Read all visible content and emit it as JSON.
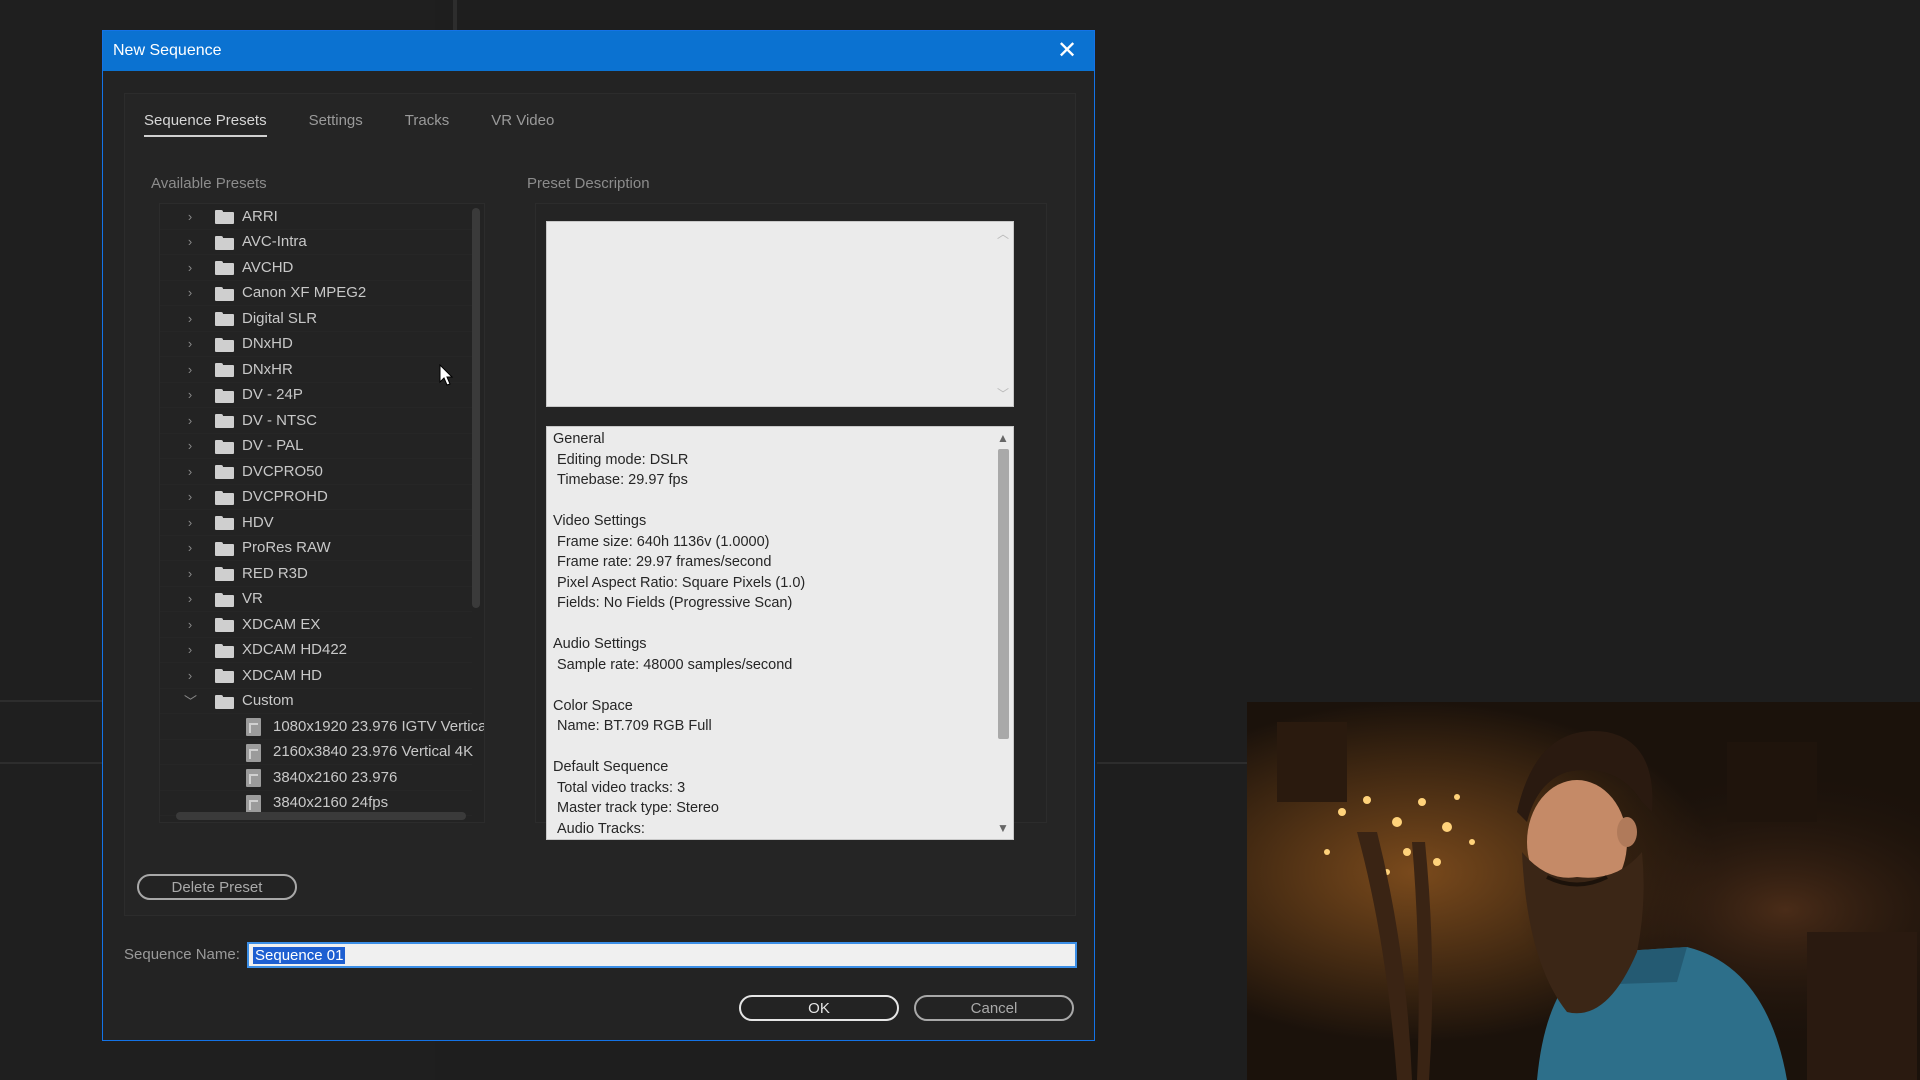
{
  "dialog": {
    "title": "New Sequence",
    "tabs": [
      "Sequence Presets",
      "Settings",
      "Tracks",
      "VR Video"
    ],
    "active_tab": "Sequence Presets",
    "available_presets_label": "Available Presets",
    "preset_description_label": "Preset Description",
    "presets": [
      {
        "label": "ARRI",
        "expanded": false
      },
      {
        "label": "AVC-Intra",
        "expanded": false
      },
      {
        "label": "AVCHD",
        "expanded": false
      },
      {
        "label": "Canon XF MPEG2",
        "expanded": false
      },
      {
        "label": "Digital SLR",
        "expanded": false
      },
      {
        "label": "DNxHD",
        "expanded": false
      },
      {
        "label": "DNxHR",
        "expanded": false
      },
      {
        "label": "DV - 24P",
        "expanded": false
      },
      {
        "label": "DV - NTSC",
        "expanded": false
      },
      {
        "label": "DV - PAL",
        "expanded": false
      },
      {
        "label": "DVCPRO50",
        "expanded": false
      },
      {
        "label": "DVCPROHD",
        "expanded": false
      },
      {
        "label": "HDV",
        "expanded": false
      },
      {
        "label": "ProRes RAW",
        "expanded": false
      },
      {
        "label": "RED R3D",
        "expanded": false
      },
      {
        "label": "VR",
        "expanded": false
      },
      {
        "label": "XDCAM EX",
        "expanded": false
      },
      {
        "label": "XDCAM HD422",
        "expanded": false
      },
      {
        "label": "XDCAM HD",
        "expanded": false
      },
      {
        "label": "Custom",
        "expanded": true
      }
    ],
    "custom_presets": [
      "1080x1920 23.976 IGTV Vertica",
      "2160x3840 23.976 Vertical 4K",
      "3840x2160 23.976",
      "3840x2160 24fps"
    ],
    "description_lines": [
      {
        "type": "head",
        "text": "General"
      },
      {
        "type": "row",
        "text": "Editing mode: DSLR"
      },
      {
        "type": "row",
        "text": "Timebase: 29.97 fps"
      },
      {
        "type": "gap",
        "text": ""
      },
      {
        "type": "head",
        "text": "Video Settings"
      },
      {
        "type": "row",
        "text": "Frame size: 640h 1136v (1.0000)"
      },
      {
        "type": "row",
        "text": "Frame rate: 29.97  frames/second"
      },
      {
        "type": "row",
        "text": "Pixel Aspect Ratio: Square Pixels (1.0)"
      },
      {
        "type": "row",
        "text": "Fields: No Fields (Progressive Scan)"
      },
      {
        "type": "gap",
        "text": ""
      },
      {
        "type": "head",
        "text": "Audio Settings"
      },
      {
        "type": "row",
        "text": "Sample rate: 48000 samples/second"
      },
      {
        "type": "gap",
        "text": ""
      },
      {
        "type": "head",
        "text": "Color Space"
      },
      {
        "type": "row",
        "text": "Name: BT.709 RGB Full"
      },
      {
        "type": "gap",
        "text": ""
      },
      {
        "type": "head",
        "text": "Default Sequence"
      },
      {
        "type": "row",
        "text": "Total video tracks: 3"
      },
      {
        "type": "row",
        "text": "Master track type: Stereo"
      },
      {
        "type": "row",
        "text": "Audio Tracks:"
      }
    ],
    "delete_preset_label": "Delete Preset",
    "sequence_name_label": "Sequence Name:",
    "sequence_name_value": "Sequence 01",
    "ok_label": "OK",
    "cancel_label": "Cancel"
  },
  "colors": {
    "titlebar": "#0b72d1",
    "background": "#1e1e1e",
    "dialog": "#232323",
    "selection": "#1e5fd1"
  }
}
